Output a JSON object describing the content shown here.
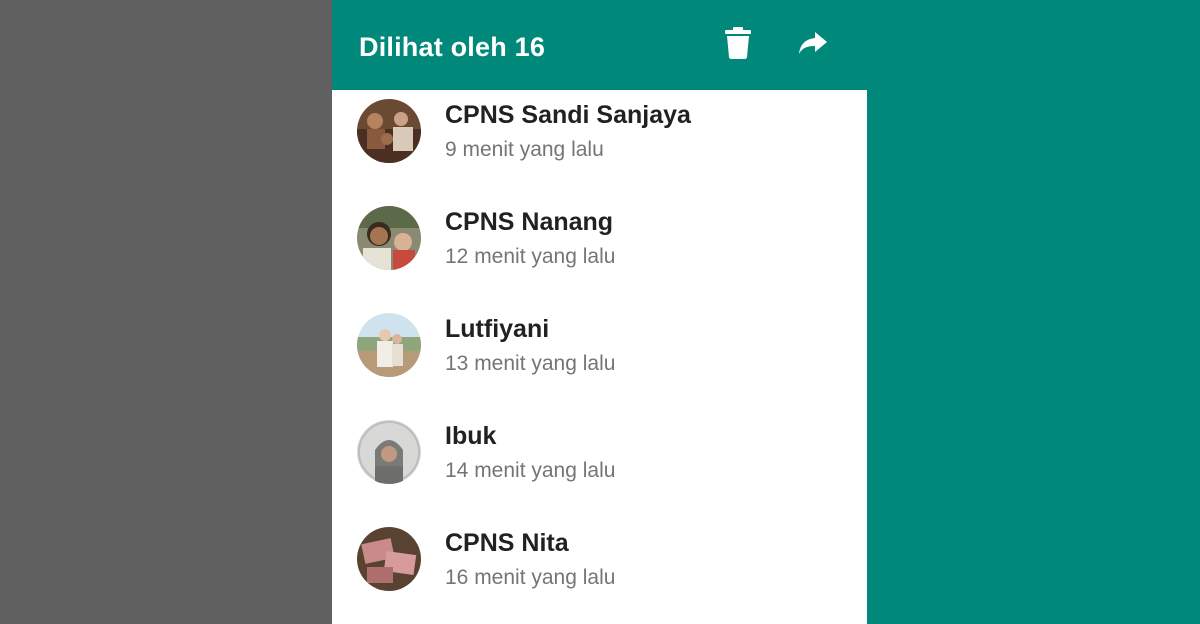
{
  "header": {
    "title": "Dilihat oleh 16",
    "delete_icon": "delete-icon",
    "share_icon": "share-icon"
  },
  "colors": {
    "accent": "#00897b",
    "left_background": "#616161",
    "name_text": "#212121",
    "time_text": "#757575"
  },
  "viewers": [
    {
      "name": "CPNS Sandi Sanjaya",
      "time": "9 menit yang lalu"
    },
    {
      "name": "CPNS Nanang",
      "time": "12 menit yang lalu"
    },
    {
      "name": "Lutfiyani",
      "time": "13 menit yang lalu"
    },
    {
      "name": "Ibuk",
      "time": "14 menit yang lalu"
    },
    {
      "name": "CPNS Nita",
      "time": "16 menit yang lalu"
    }
  ]
}
